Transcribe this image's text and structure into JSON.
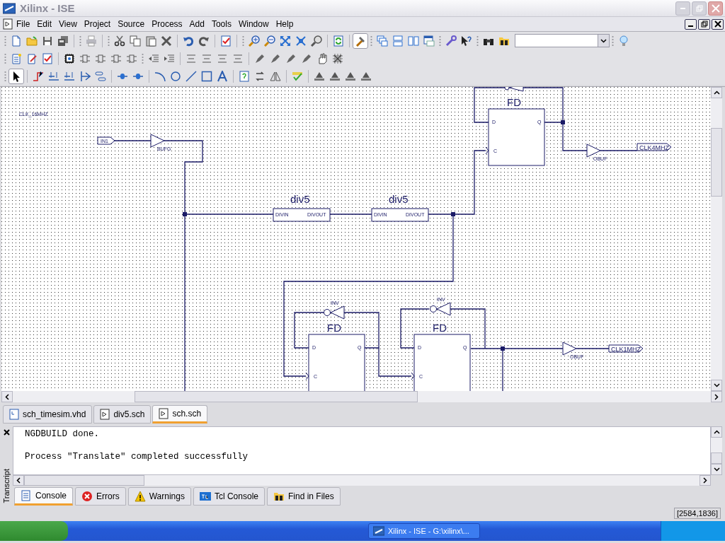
{
  "window": {
    "title": "Xilinx - ISE"
  },
  "menu": [
    "File",
    "Edit",
    "View",
    "Project",
    "Source",
    "Process",
    "Add",
    "Tools",
    "Window",
    "Help"
  ],
  "schematic": {
    "note": "CLK_16MHZ",
    "input_port": "IN1",
    "output_ports": [
      "CLK4MHZ",
      "CLK1MHZ"
    ],
    "buffers": [
      {
        "label": "BUFG"
      },
      {
        "label": "OBUF"
      },
      {
        "label": "OBUF"
      }
    ],
    "dividers": [
      {
        "name": "div5",
        "pin_in": "DIVIN",
        "pin_out": "DIVOUT"
      },
      {
        "name": "div5",
        "pin_in": "DIVIN",
        "pin_out": "DIVOUT"
      }
    ],
    "flip_flops": [
      {
        "name": "FD",
        "pin_d": "D",
        "pin_q": "Q",
        "pin_c": "C"
      },
      {
        "name": "FD",
        "pin_d": "D",
        "pin_q": "Q",
        "pin_c": "C"
      },
      {
        "name": "FD",
        "pin_d": "D",
        "pin_q": "Q",
        "pin_c": "C"
      }
    ],
    "inverters": [
      {
        "label": "INV"
      },
      {
        "label": "INV"
      }
    ]
  },
  "editor_tabs": [
    {
      "label": "sch_timesim.vhd",
      "kind": "vhdl",
      "selected": false
    },
    {
      "label": "div5.sch",
      "kind": "schematic",
      "selected": false
    },
    {
      "label": "sch.sch",
      "kind": "schematic",
      "selected": true
    }
  ],
  "console": {
    "side_label": "Transcript",
    "lines": [
      "NGDBUILD done.",
      "Process \"Translate\" completed successfully"
    ]
  },
  "console_tabs": [
    {
      "label": "Console",
      "kind": "console",
      "selected": true
    },
    {
      "label": "Errors",
      "kind": "errors",
      "selected": false
    },
    {
      "label": "Warnings",
      "kind": "warnings",
      "selected": false
    },
    {
      "label": "Tcl Console",
      "kind": "tcl",
      "selected": false
    },
    {
      "label": "Find in Files",
      "kind": "find",
      "selected": false
    }
  ],
  "status_bar": {
    "coordinates": "[2584,1836]"
  },
  "taskbar": {
    "items": [
      {
        "label": "Xilinx - ISE - G:\\xilinx\\..."
      }
    ]
  }
}
